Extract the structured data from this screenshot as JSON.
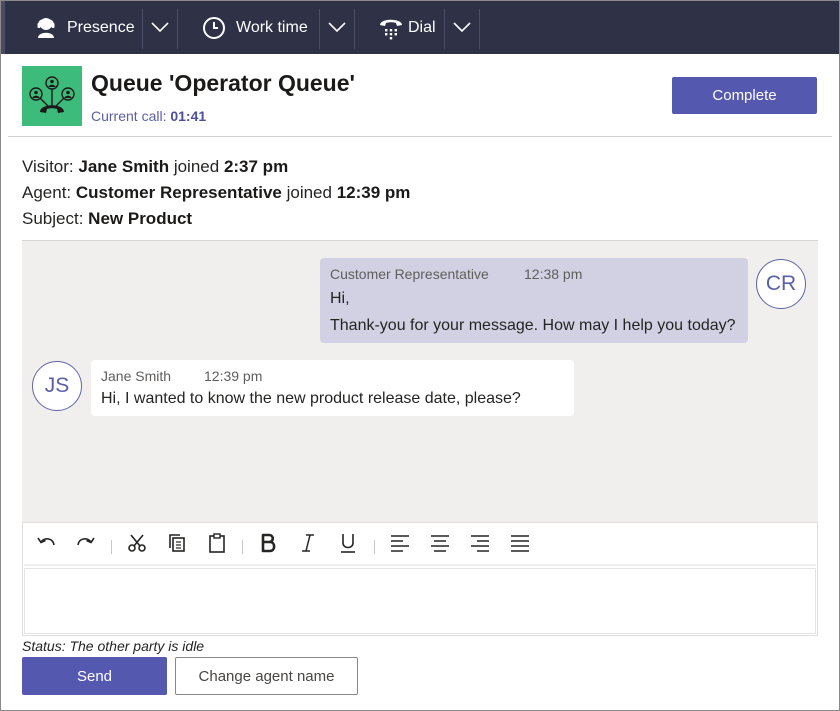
{
  "topbar": {
    "presence": {
      "label": "Presence",
      "icon": "presence-icon"
    },
    "work_time": {
      "label": "Work time",
      "icon": "clock-icon"
    },
    "dial": {
      "label": "Dial",
      "icon": "phone-icon"
    }
  },
  "header": {
    "title": "Queue 'Operator Queue'",
    "current_call_label": "Current call:",
    "current_call_time": "01:41",
    "complete_label": "Complete",
    "logo_icon": "queue-people-icon"
  },
  "info": {
    "visitor_label": "Visitor:",
    "visitor_name": "Jane Smith",
    "visitor_joined": "joined",
    "visitor_time": "2:37 pm",
    "agent_label": "Agent:",
    "agent_name": "Customer Representative",
    "agent_joined": "joined",
    "agent_time": "12:39 pm",
    "subject_label": "Subject:",
    "subject_value": "New Product"
  },
  "messages": [
    {
      "sender": "Customer Representative",
      "time": "12:38 pm",
      "lines": [
        "Hi,",
        "Thank-you for your message. How may I help you today?"
      ],
      "avatar": "CR"
    },
    {
      "sender": "Jane Smith",
      "time": "12:39 pm",
      "lines": [
        "Hi, I wanted to know the new product release date, please?"
      ],
      "avatar": "JS"
    }
  ],
  "editor": {
    "tools": [
      "undo-icon",
      "redo-icon",
      "cut-icon",
      "copy-icon",
      "paste-icon",
      "bold-icon",
      "italic-icon",
      "underline-icon",
      "align-left-icon",
      "align-center-icon",
      "align-right-icon",
      "justify-icon"
    ],
    "compose_value": ""
  },
  "footer": {
    "status": "Status: The other party is idle",
    "send_label": "Send",
    "change_agent_label": "Change agent name"
  },
  "colors": {
    "topbar": "#2f3147",
    "accent": "#5558af",
    "logo_green": "#3dbb7b",
    "outgoing_bubble": "#d1d1e3",
    "chat_bg": "#f0efee"
  }
}
